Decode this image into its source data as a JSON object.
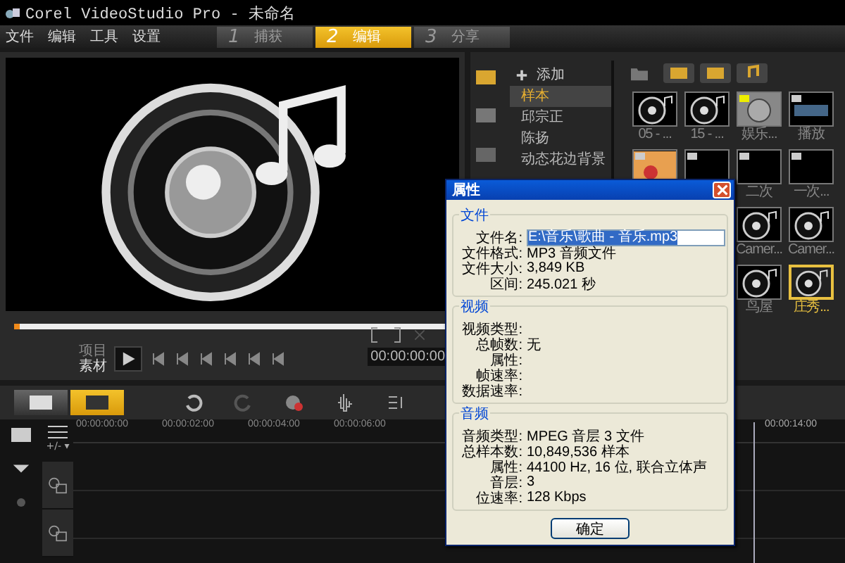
{
  "window": {
    "title": "Corel VideoStudio Pro - 未命名"
  },
  "menu": [
    "文件",
    "编辑",
    "工具",
    "设置"
  ],
  "steps": [
    {
      "number": "1",
      "label": "捕获",
      "selected": false
    },
    {
      "number": "2",
      "label": "编辑",
      "selected": true
    },
    {
      "number": "3",
      "label": "分享",
      "selected": false
    }
  ],
  "library": {
    "add_label": "添加",
    "categories": [
      {
        "label": "样本",
        "selected": true
      },
      {
        "label": "邱宗正",
        "selected": false
      },
      {
        "label": "陈扬",
        "selected": false
      },
      {
        "label": "动态花边背景",
        "selected": false
      }
    ],
    "items": [
      {
        "kind": "disc",
        "label": "05 - ...",
        "selected": false
      },
      {
        "kind": "disc",
        "label": "15 - ...",
        "selected": false
      },
      {
        "kind": "countdown",
        "label": "娱乐...",
        "selected": false
      },
      {
        "kind": "video",
        "label": "播放",
        "selected": false
      },
      {
        "kind": "photo",
        "selected": false
      },
      {
        "kind": "black",
        "selected": false
      },
      {
        "kind": "black",
        "label": "二次",
        "selected": false
      },
      {
        "kind": "black",
        "label": "一次...",
        "selected": false
      },
      {
        "kind": "covered"
      },
      {
        "kind": "covered"
      },
      {
        "kind": "disc",
        "label": "Camer...",
        "selected": false
      },
      {
        "kind": "disc",
        "label": "Camer...",
        "selected": false
      },
      {
        "kind": "covered"
      },
      {
        "kind": "covered"
      },
      {
        "kind": "disc",
        "label": "鸟屋",
        "selected": false
      },
      {
        "kind": "disc",
        "label": "庄秀...",
        "selected": true
      }
    ]
  },
  "player": {
    "mode_labels": [
      "项目",
      "素材"
    ],
    "timecode": "00:00:00:00"
  },
  "timeline": {
    "ruler": [
      "00:00:00:00",
      "00:00:02:00",
      "00:00:04:00",
      "00:00:06:00"
    ],
    "ruler_end": "00:00:14:00",
    "track_tools": "+/- ▾"
  },
  "dialog": {
    "title": "属性",
    "button": "确定",
    "groups": [
      {
        "title": "文件",
        "rows": [
          {
            "label": "文件名:",
            "value": "E:\\音乐\\歌曲 - 音乐.mp3",
            "kind": "field"
          },
          {
            "label": "文件格式:",
            "value": "MP3 音频文件",
            "kind": "text"
          },
          {
            "label": "文件大小:",
            "value": "3,849 KB",
            "kind": "text"
          },
          {
            "label": "区间:",
            "value": "245.021 秒",
            "kind": "text"
          }
        ]
      },
      {
        "title": "视频",
        "rows": [
          {
            "label": "视频类型:",
            "kind": "text"
          },
          {
            "label": "总帧数:",
            "value": "无",
            "kind": "text"
          },
          {
            "label": "属性:",
            "kind": "text"
          },
          {
            "label": "帧速率:",
            "kind": "text"
          },
          {
            "label": "数据速率:",
            "kind": "text"
          }
        ]
      },
      {
        "title": "音频",
        "rows": [
          {
            "label": "音频类型:",
            "value": "MPEG 音层 3 文件",
            "kind": "text"
          },
          {
            "label": "总样本数:",
            "value": "10,849,536 样本",
            "kind": "text"
          },
          {
            "label": "属性:",
            "value": "44100 Hz, 16 位, 联合立体声",
            "kind": "text"
          },
          {
            "label": "音层:",
            "value": "3",
            "kind": "text"
          },
          {
            "label": "位速率:",
            "value": "128 Kbps",
            "kind": "text"
          }
        ]
      }
    ]
  }
}
